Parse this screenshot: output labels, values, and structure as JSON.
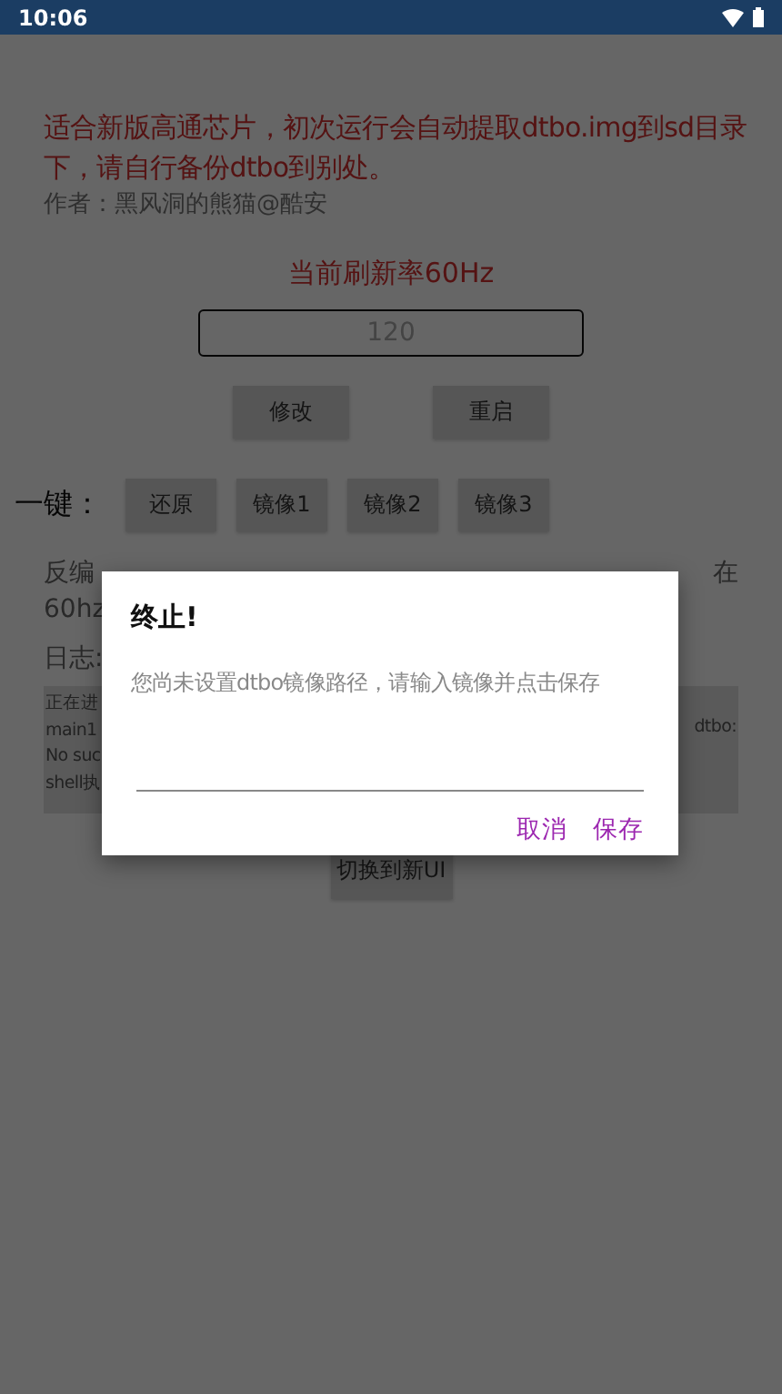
{
  "status_bar": {
    "time": "10:06"
  },
  "notice": {
    "text": "适合新版高通芯片，初次运行会自动提取dtbo.img到sd目录下，请自行备份dtbo到别处。",
    "author": "作者：黑风洞的熊猫@酷安"
  },
  "refresh": {
    "label": "当前刷新率60Hz",
    "input": {
      "placeholder": "120"
    },
    "buttons": [
      "修改",
      "重启"
    ]
  },
  "one_key": {
    "label": "一键：",
    "buttons": [
      "还原",
      "镜像1",
      "镜像2",
      "镜像3"
    ]
  },
  "info": {
    "line_1_start": "反编",
    "line_1_end": "在",
    "line_2_start": "60hz"
  },
  "log": {
    "label": "日志:",
    "lines": [
      "正在进",
      "main1",
      "No suc",
      "shell执"
    ],
    "right_fragment": "dtbo:"
  },
  "switch_button": "切换到新UI",
  "dialog": {
    "title": "终止!",
    "message": "您尚未设置dtbo镜像路径，请输入镜像并点击保存",
    "buttons": [
      "取消",
      "保存"
    ]
  }
}
